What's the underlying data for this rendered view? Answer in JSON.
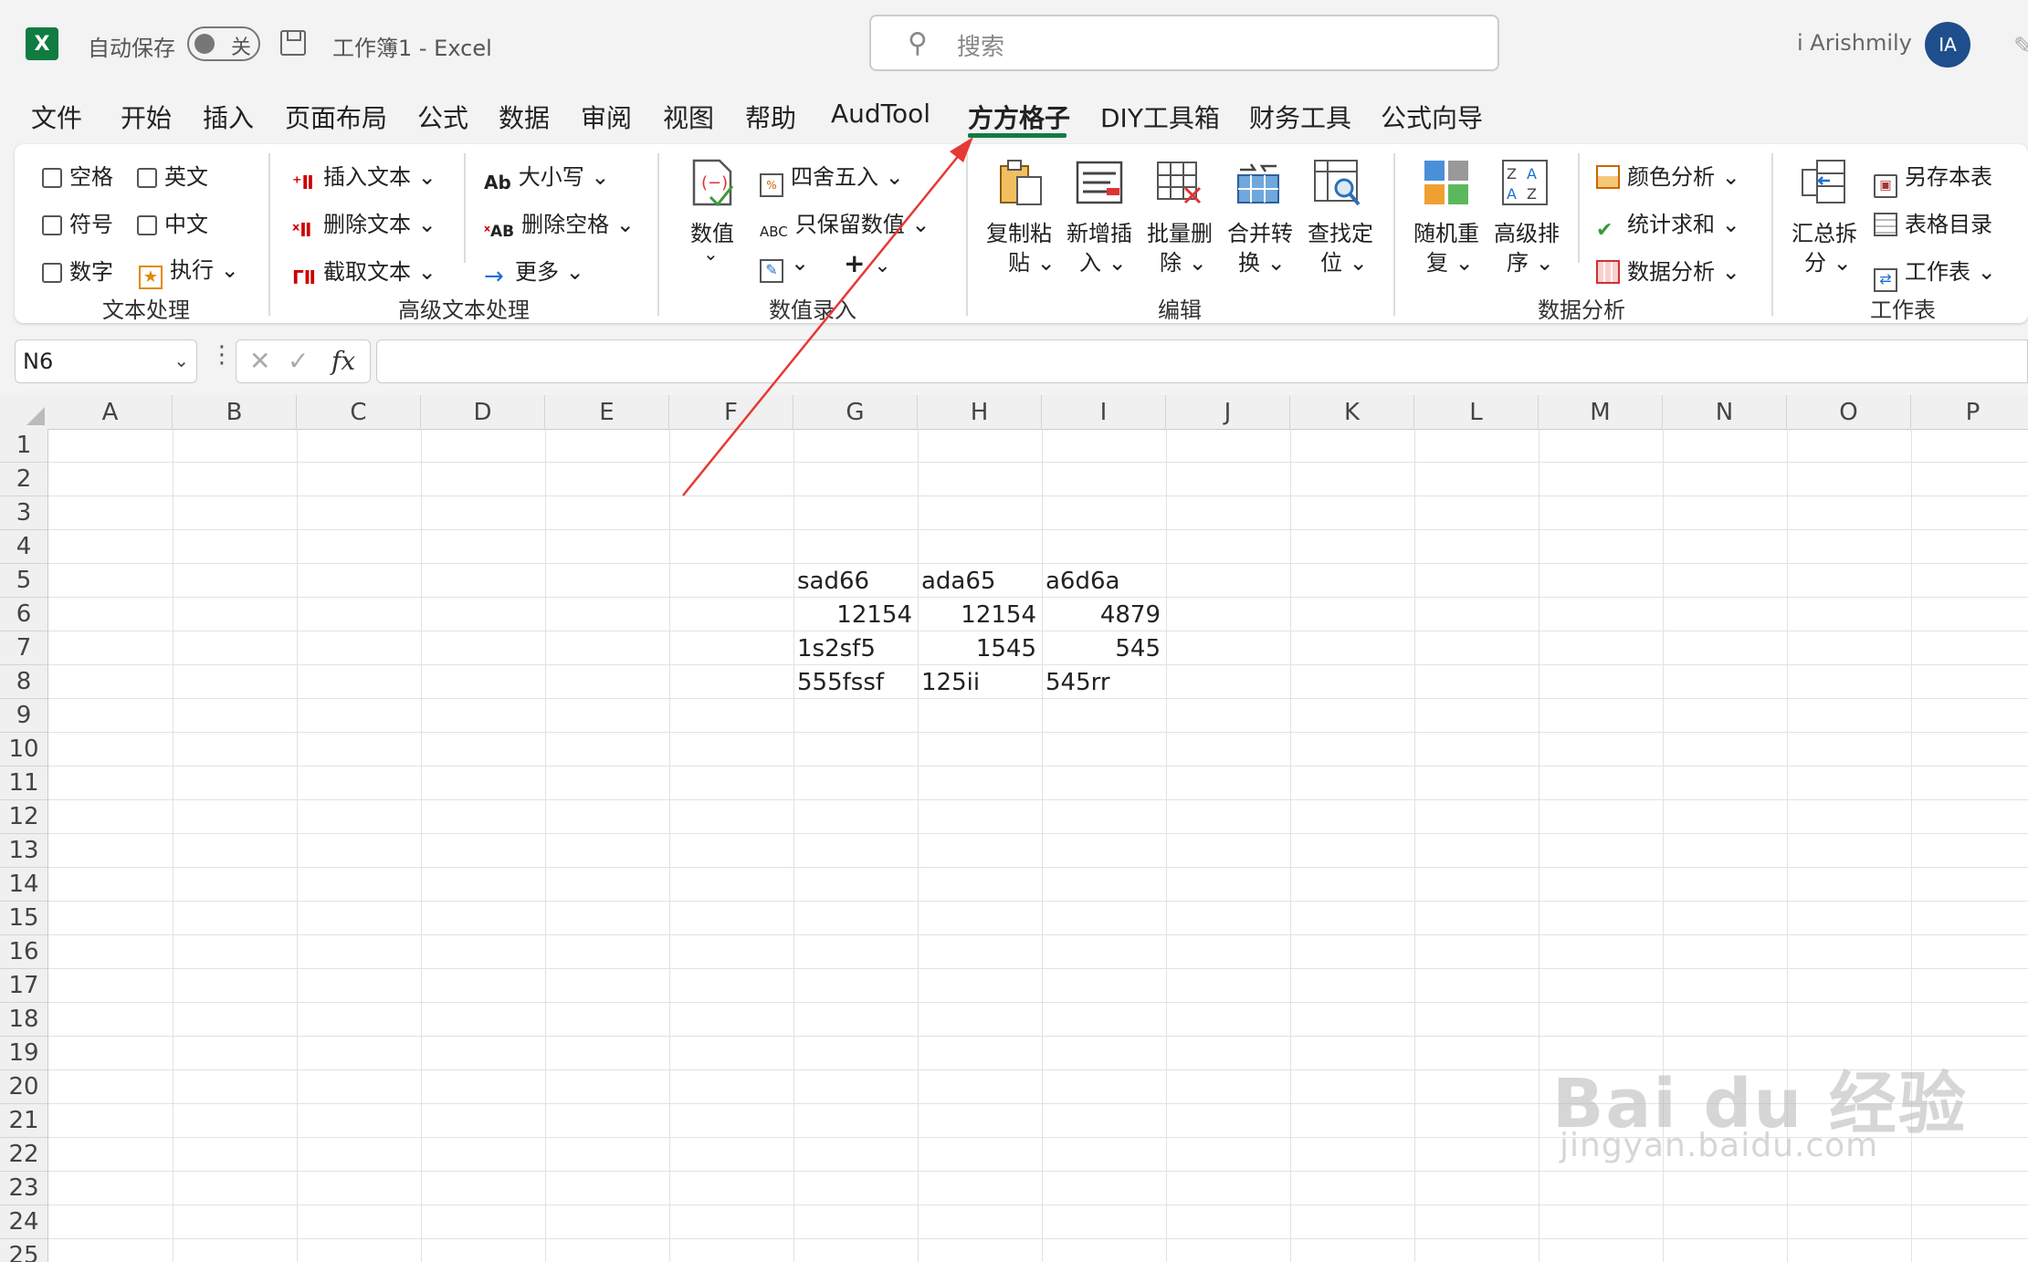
{
  "titlebar": {
    "app_logo": "X",
    "autosave_label": "自动保存",
    "autosave_state": "关",
    "doc_title": "工作簿1  -  Excel",
    "search_placeholder": "搜索",
    "user_name": "i Arishmily",
    "user_initials": "IA"
  },
  "menu": {
    "tabs": [
      "文件",
      "开始",
      "插入",
      "页面布局",
      "公式",
      "数据",
      "审阅",
      "视图",
      "帮助",
      "AudTool",
      "方方格子",
      "DIY工具箱",
      "财务工具",
      "公式向导"
    ],
    "active": "方方格子"
  },
  "ribbon": {
    "text_process": {
      "items": [
        "空格",
        "英文",
        "符号",
        "中文",
        "数字",
        "执行"
      ],
      "label": "文本处理"
    },
    "adv_text": {
      "items": [
        "插入文本",
        "删除文本",
        "截取文本",
        "大小写",
        "删除空格",
        "更多"
      ],
      "label": "高级文本处理"
    },
    "num_entry": {
      "big": "数值",
      "items": [
        "四舍五入",
        "只保留数值"
      ],
      "label": "数值录入"
    },
    "edit": {
      "buttons": [
        [
          "复制粘",
          "贴"
        ],
        [
          "新增插",
          "入"
        ],
        [
          "批量删",
          "除"
        ],
        [
          "合并转",
          "换"
        ],
        [
          "查找定",
          "位"
        ]
      ],
      "label": "编辑"
    },
    "data_analysis": {
      "buttons": [
        [
          "随机重",
          "复"
        ],
        [
          "高级排",
          "序"
        ]
      ],
      "items": [
        "颜色分析",
        "统计求和",
        "数据分析"
      ],
      "label": "数据分析"
    },
    "worksheet": {
      "big": [
        "汇总拆",
        "分"
      ],
      "items": [
        "另存本表",
        "表格目录",
        "工作表"
      ],
      "label": "工作表"
    }
  },
  "formula_bar": {
    "name_box": "N6",
    "fx": "fx",
    "formula": ""
  },
  "grid": {
    "columns": [
      "A",
      "B",
      "C",
      "D",
      "E",
      "F",
      "G",
      "H",
      "I",
      "J",
      "K",
      "L",
      "M",
      "N",
      "O",
      "P"
    ],
    "rows": [
      "1",
      "2",
      "3",
      "4",
      "5",
      "6",
      "7",
      "8",
      "9",
      "10",
      "11",
      "12",
      "13",
      "14",
      "15",
      "16",
      "17",
      "18",
      "19",
      "20",
      "21",
      "22",
      "23",
      "24",
      "25"
    ],
    "cells": [
      {
        "ref": "G5",
        "value": "sad66",
        "align": "left"
      },
      {
        "ref": "H5",
        "value": "ada65",
        "align": "left"
      },
      {
        "ref": "I5",
        "value": "a6d6a",
        "align": "left"
      },
      {
        "ref": "G6",
        "value": "12154",
        "align": "right"
      },
      {
        "ref": "H6",
        "value": "12154",
        "align": "right"
      },
      {
        "ref": "I6",
        "value": "4879",
        "align": "right"
      },
      {
        "ref": "G7",
        "value": "1s2sf5",
        "align": "left"
      },
      {
        "ref": "H7",
        "value": "1545",
        "align": "right"
      },
      {
        "ref": "I7",
        "value": "545",
        "align": "right"
      },
      {
        "ref": "G8",
        "value": "555fssf",
        "align": "left"
      },
      {
        "ref": "H8",
        "value": "125ii",
        "align": "left"
      },
      {
        "ref": "I8",
        "value": "545rr",
        "align": "left"
      }
    ]
  },
  "watermark": {
    "line1": "Bai du 经验",
    "line2": "jingyan.baidu.com"
  },
  "colors": {
    "accent": "#107c41",
    "arrow": "#e53935",
    "avatar": "#1f4e8c"
  }
}
